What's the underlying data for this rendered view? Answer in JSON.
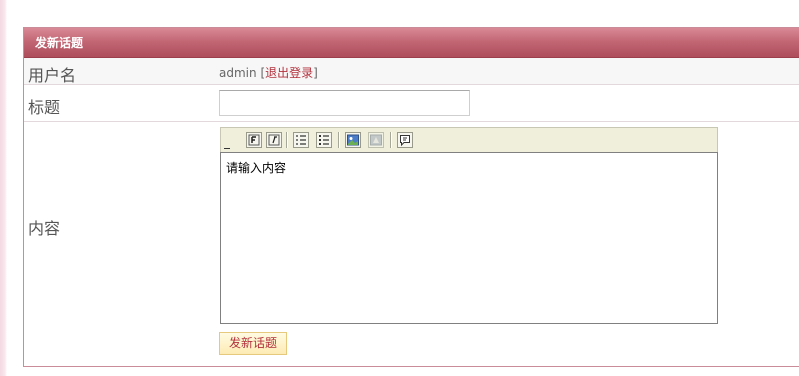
{
  "form": {
    "header_title": "发新话题",
    "username_label": "用户名",
    "username_value": "admin",
    "logout_open": "[",
    "logout_label": "退出登录",
    "logout_close": "]",
    "title_label": "标题",
    "title_value": "",
    "content_label": "内容",
    "content_value": "请输入内容",
    "submit_label": "发新话题"
  },
  "toolbar": {
    "buttons": [
      {
        "icon": "bold-block-icon"
      },
      {
        "icon": "italic-block-icon"
      },
      {
        "icon": "ordered-list-icon"
      },
      {
        "icon": "unordered-list-icon"
      },
      {
        "icon": "insert-image-icon"
      },
      {
        "icon": "insert-flash-icon"
      },
      {
        "icon": "insert-quote-icon"
      }
    ]
  },
  "colors": {
    "header_bg": "#c36775",
    "panel_border": "#c98c98",
    "link": "#b2323d",
    "submit_bg": "#fdebb4",
    "toolbar_bg": "#efefdc"
  }
}
